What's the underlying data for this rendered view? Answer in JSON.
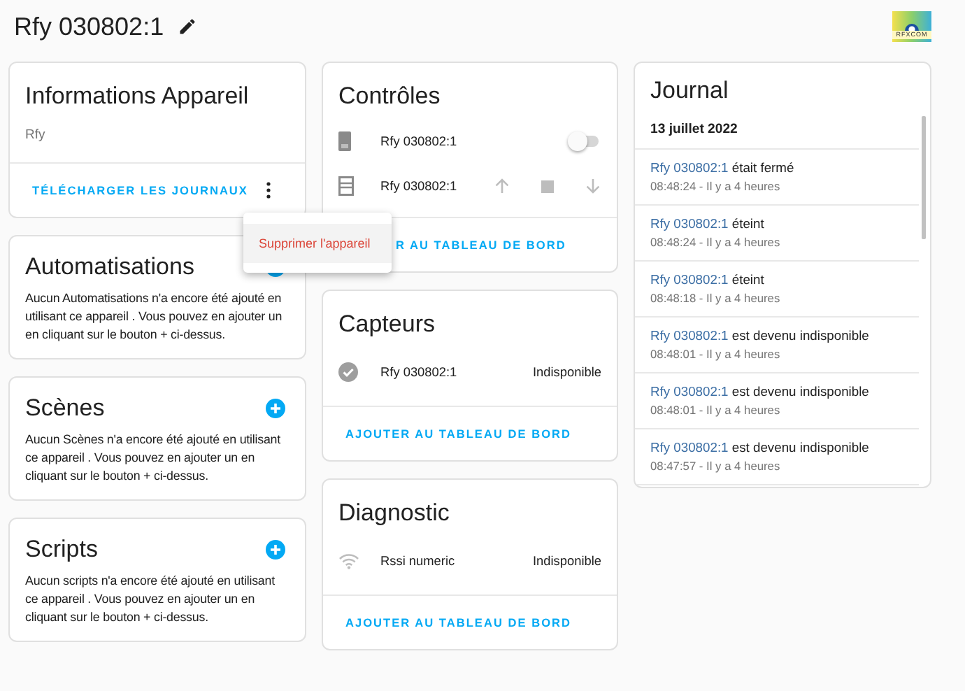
{
  "header": {
    "title": "Rfy 030802:1",
    "logo_text": "RFXCOM"
  },
  "device_info": {
    "title": "Informations Appareil",
    "model": "Rfy",
    "action": "TÉLÉCHARGER LES JOURNAUX"
  },
  "menu": {
    "items": [
      "Supprimer l'appareil"
    ]
  },
  "related": [
    {
      "title": "Automatisations",
      "text": "Aucun Automatisations n'a encore été ajouté en utilisant ce appareil . Vous pouvez en ajouter un en cliquant sur le bouton + ci-dessus."
    },
    {
      "title": "Scènes",
      "text": "Aucun Scènes n'a encore été ajouté en utilisant ce appareil . Vous pouvez en ajouter un en cliquant sur le bouton + ci-dessus."
    },
    {
      "title": "Scripts",
      "text": "Aucun scripts n'a encore été ajouté en utilisant ce appareil . Vous pouvez en ajouter un en cliquant sur le bouton + ci-dessus."
    }
  ],
  "entity_cards": [
    {
      "title": "Contrôles",
      "rows": [
        {
          "kind": "toggle",
          "name": "Rfy 030802:1",
          "on": false
        },
        {
          "kind": "cover",
          "name": "Rfy 030802:1"
        }
      ],
      "action": "R AU TABLEAU DE BORD",
      "covered": true
    },
    {
      "title": "Capteurs",
      "rows": [
        {
          "kind": "sensor",
          "name": "Rfy 030802:1",
          "state": "Indisponible"
        }
      ],
      "action": "AJOUTER AU TABLEAU DE BORD",
      "covered": false
    },
    {
      "title": "Diagnostic",
      "rows": [
        {
          "kind": "signal",
          "name": "Rssi numeric",
          "state": "Indisponible"
        }
      ],
      "action": "AJOUTER AU TABLEAU DE BORD",
      "covered": false
    }
  ],
  "journal": {
    "title": "Journal",
    "date": "13 juillet 2022",
    "entries": [
      {
        "entity": "Rfy 030802:1",
        "message": "était fermé",
        "time": "08:48:24 - Il y a 4 heures"
      },
      {
        "entity": "Rfy 030802:1",
        "message": "éteint",
        "time": "08:48:24 - Il y a 4 heures"
      },
      {
        "entity": "Rfy 030802:1",
        "message": "éteint",
        "time": "08:48:18 - Il y a 4 heures"
      },
      {
        "entity": "Rfy 030802:1",
        "message": "est devenu indisponible",
        "time": "08:48:01 - Il y a 4 heures"
      },
      {
        "entity": "Rfy 030802:1",
        "message": "est devenu indisponible",
        "time": "08:48:01 - Il y a 4 heures"
      },
      {
        "entity": "Rfy 030802:1",
        "message": "est devenu indisponible",
        "time": "08:47:57 - Il y a 4 heures"
      }
    ]
  }
}
